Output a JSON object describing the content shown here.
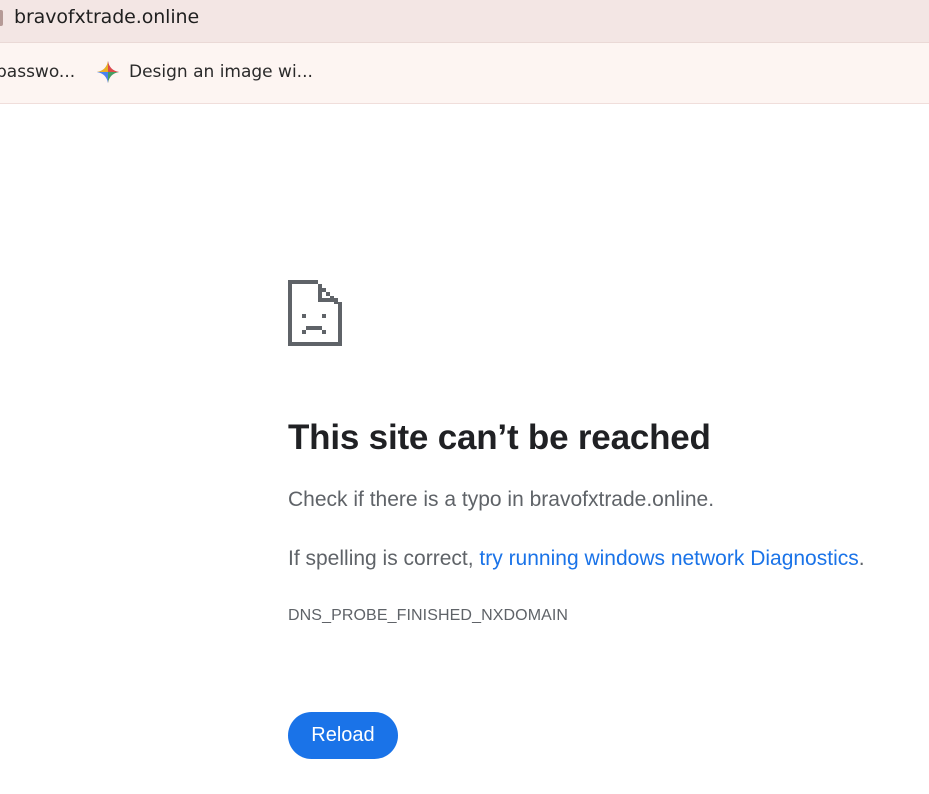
{
  "browser": {
    "url": "bravofxtrade.online",
    "bookmarks": [
      {
        "label": "passwo...",
        "icon": ""
      },
      {
        "label": "Design an image wi...",
        "icon": "sparkle-icon"
      }
    ]
  },
  "error_page": {
    "icon": "sad-page-icon",
    "heading": "This site can’t be reached",
    "paragraph_1": "Check if there is a typo in bravofxtrade.online.",
    "paragraph_2_prefix": "If spelling is correct, ",
    "paragraph_2_link": "try running windows network Diagnostics",
    "paragraph_2_suffix": ".",
    "error_code": "DNS_PROBE_FINISHED_NXDOMAIN",
    "reload_label": "Reload"
  },
  "colors": {
    "accent": "#1a73e8",
    "heading_text": "#202124",
    "body_text": "#5f6368",
    "address_bar_bg": "#f3e6e4",
    "bookmarks_bar_bg": "#fdf5f2"
  }
}
